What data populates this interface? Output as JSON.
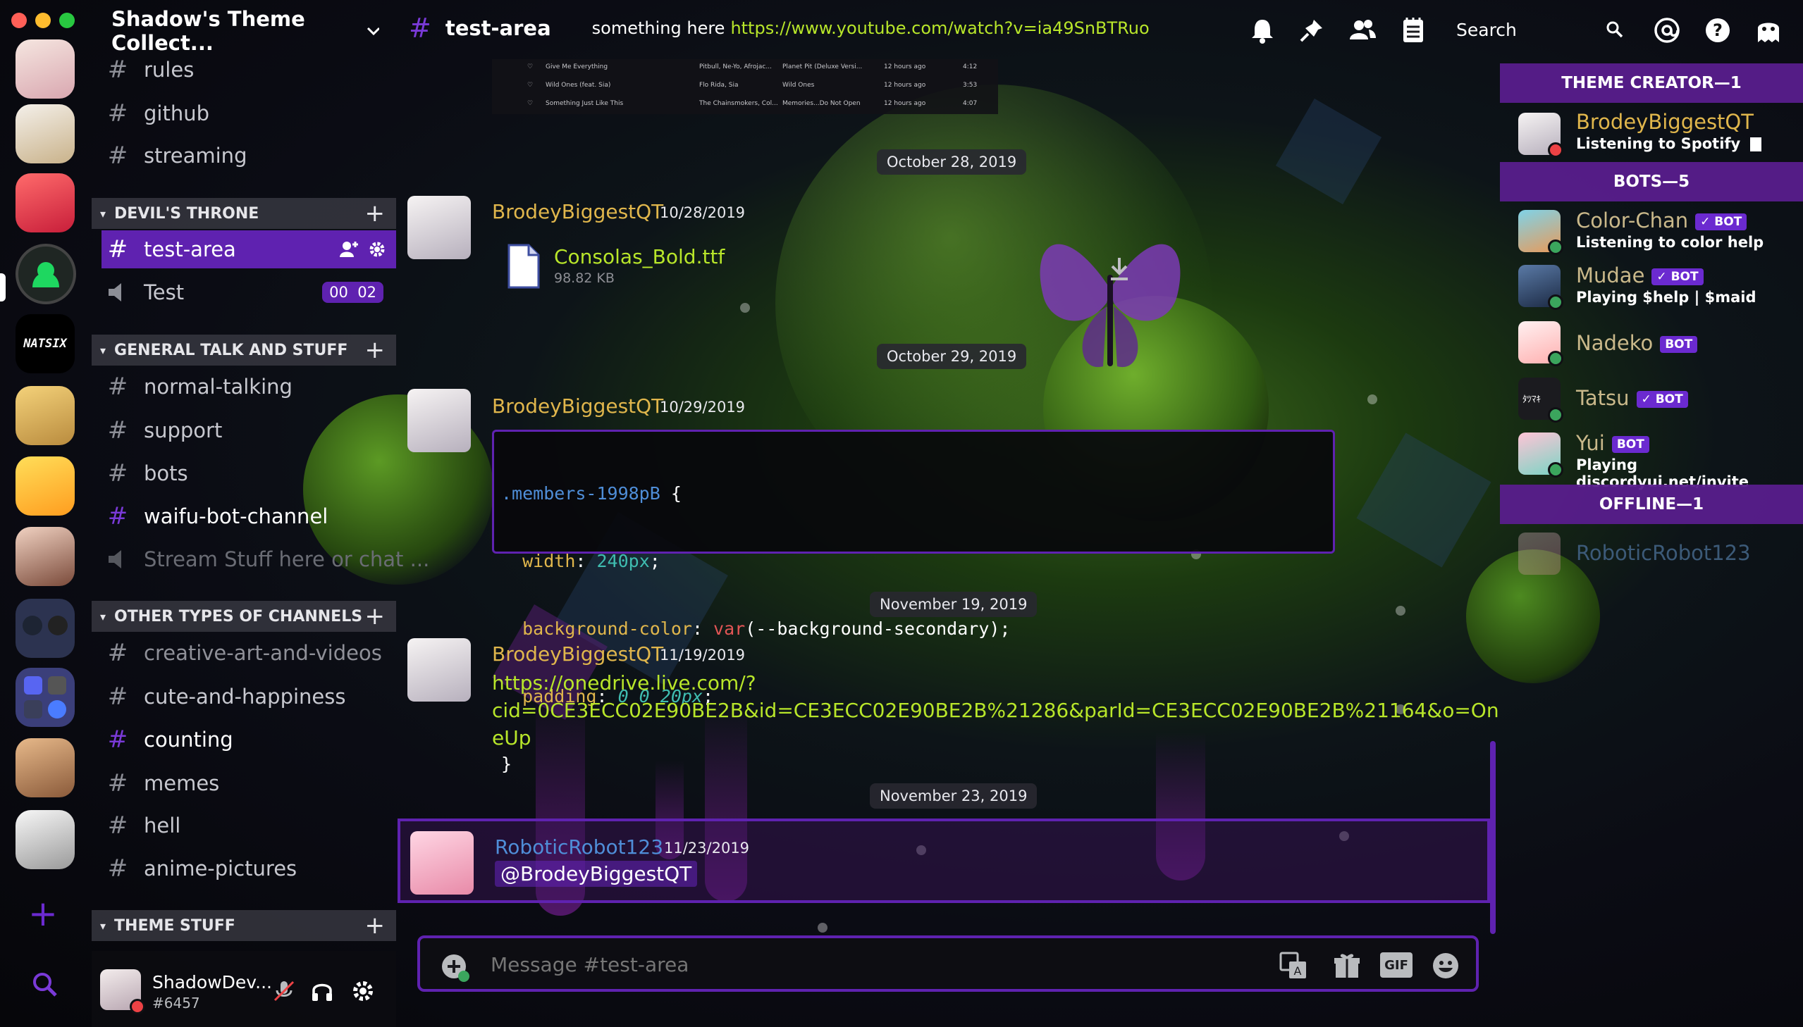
{
  "window": {
    "traffic_colors": [
      "#ff5f57",
      "#febc2e",
      "#28c840"
    ]
  },
  "server": {
    "name": "Shadow's Theme Collect...",
    "logo_text": "NATSIX"
  },
  "channels": {
    "top": [
      "rules",
      "github",
      "streaming"
    ],
    "categories": [
      {
        "name": "DEVIL'S THRONE",
        "items": [
          {
            "type": "text",
            "name": "test-area",
            "selected": true
          },
          {
            "type": "voice",
            "name": "Test",
            "counts": [
              "00",
              "02"
            ]
          }
        ]
      },
      {
        "name": "GENERAL TALK AND STUFF",
        "items": [
          {
            "type": "text",
            "name": "normal-talking"
          },
          {
            "type": "text",
            "name": "support"
          },
          {
            "type": "text",
            "name": "bots"
          },
          {
            "type": "text",
            "name": "waifu-bot-channel"
          },
          {
            "type": "voice",
            "name": "Stream Stuff here or chat ..."
          }
        ]
      },
      {
        "name": "OTHER TYPES OF CHANNELS",
        "items": [
          {
            "type": "text",
            "name": "creative-art-and-videos"
          },
          {
            "type": "text",
            "name": "cute-and-happiness"
          },
          {
            "type": "text",
            "name": "counting"
          },
          {
            "type": "text",
            "name": "memes"
          },
          {
            "type": "text",
            "name": "hell"
          },
          {
            "type": "text",
            "name": "anime-pictures"
          }
        ]
      },
      {
        "name": "THEME STUFF",
        "items": []
      }
    ]
  },
  "user": {
    "name": "ShadowDev...",
    "tag": "#6457"
  },
  "header": {
    "channel": "test-area",
    "topic_prefix": "something here",
    "topic_link": "https://www.youtube.com/watch?v=ia49SnBTRuo",
    "search_placeholder": "Search"
  },
  "embed_table": [
    [
      "Give Me Everything",
      "Pitbull, Ne-Yo, Afrojac...",
      "Planet Pit (Deluxe Versi...",
      "12 hours ago",
      "4:12"
    ],
    [
      "Wild Ones (feat. Sia)",
      "Flo Rida, Sia",
      "Wild Ones",
      "12 hours ago",
      "3:53"
    ],
    [
      "Something Just Like This",
      "The Chainsmokers, Col...",
      "Memories...Do Not Open",
      "12 hours ago",
      "4:07"
    ]
  ],
  "messages": [
    {
      "date": "October 28, 2019",
      "author": "BrodeyBiggestQT",
      "time": "10/28/2019",
      "file_name": "Consolas_Bold.ttf",
      "file_size": "98.82 KB"
    },
    {
      "date": "October 29, 2019",
      "author": "BrodeyBiggestQT",
      "time": "10/29/2019",
      "code": {
        "selector": ".members-1998pB",
        "open": "{",
        "close": "}",
        "lines": [
          {
            "prop": "width",
            "val": "240px",
            "suffix": ";"
          },
          {
            "prop": "background-color",
            "fn": "var",
            "arg": "(--background-secondary);"
          },
          {
            "prop": "padding",
            "val": "0 0 20px",
            "suffix": ";"
          }
        ]
      }
    },
    {
      "date": "November 19, 2019",
      "author": "BrodeyBiggestQT",
      "time": "11/19/2019",
      "link_lines": [
        "https://onedrive.live.com/?",
        "cid=0CE3ECC02E90BE2B&id=CE3ECC02E90BE2B%21286&parId=CE3ECC02E90BE2B%21164&o=On",
        "eUp"
      ]
    },
    {
      "date": "November 23, 2019",
      "author": "RoboticRobot123",
      "time": "11/23/2019",
      "mention": "@BrodeyBiggestQT"
    }
  ],
  "composer": {
    "placeholder": "Message #test-area",
    "gif_label": "GIF"
  },
  "members": {
    "groups": [
      "THEME CREATOR—1",
      "BOTS—5",
      "OFFLINE—1"
    ],
    "creator": {
      "name": "BrodeyBiggestQT",
      "status": "Listening to Spotify"
    },
    "bots": [
      {
        "name": "Color-Chan",
        "badge": "✓ BOT",
        "status": "Listening to color help"
      },
      {
        "name": "Mudae",
        "badge": "✓ BOT",
        "status": "Playing $help | $maid"
      },
      {
        "name": "Nadeko",
        "badge": "BOT",
        "status": ""
      },
      {
        "name": "Tatsu",
        "badge": "✓ BOT",
        "status": ""
      },
      {
        "name": "Yui",
        "badge": "BOT",
        "status": "Playing discordyui.net/invite"
      }
    ],
    "offline": {
      "name": "RoboticRobot123"
    }
  },
  "colors": {
    "accent": "#6b2ad0",
    "link": "#b8e62a",
    "username": "#e0b64c",
    "bot_name": "#c9b88a",
    "offline_name": "#3c5a78"
  }
}
